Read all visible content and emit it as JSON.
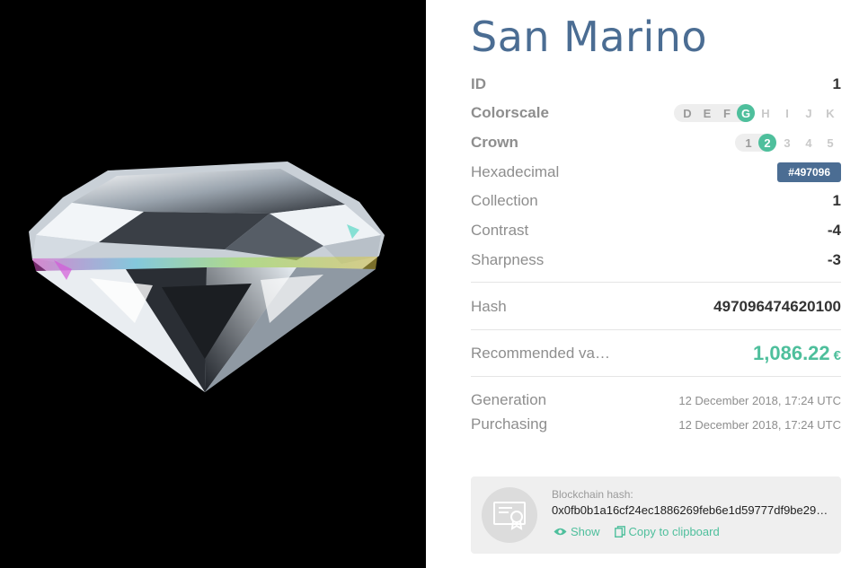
{
  "diamond": {
    "name": "San Marino",
    "id": {
      "label": "ID",
      "value": "1"
    },
    "colorscale": {
      "label": "Colorscale",
      "grades": [
        "D",
        "E",
        "F",
        "G",
        "H",
        "I",
        "J",
        "K"
      ],
      "selected": "G"
    },
    "crown": {
      "label": "Crown",
      "grades": [
        "1",
        "2",
        "3",
        "4",
        "5"
      ],
      "selected": "2"
    },
    "hexadecimal": {
      "label": "Hexadecimal",
      "value": "#497096"
    },
    "collection": {
      "label": "Collection",
      "value": "1"
    },
    "contrast": {
      "label": "Contrast",
      "value": "-4"
    },
    "sharpness": {
      "label": "Sharpness",
      "value": "-3"
    },
    "hash": {
      "label": "Hash",
      "value": "497096474620100"
    },
    "recommended": {
      "label": "Recommended va…",
      "value": "1,086.22",
      "currency": "€"
    },
    "generation": {
      "label": "Generation",
      "value": "12 December 2018, 17:24 UTC"
    },
    "purchasing": {
      "label": "Purchasing",
      "value": "12 December 2018, 17:24 UTC"
    }
  },
  "blockchain": {
    "label": "Blockchain hash:",
    "hash": "0x0fb0b1a16cf24ec1886269feb6e1d59777df9be29…",
    "show_label": "Show",
    "copy_label": "Copy to clipboard",
    "icon": "certificate-icon"
  },
  "colors": {
    "accent_green": "#4ebf9c",
    "title_blue": "#4b6d93",
    "badge_blue": "#4b6d93",
    "image_background": "#000000"
  }
}
